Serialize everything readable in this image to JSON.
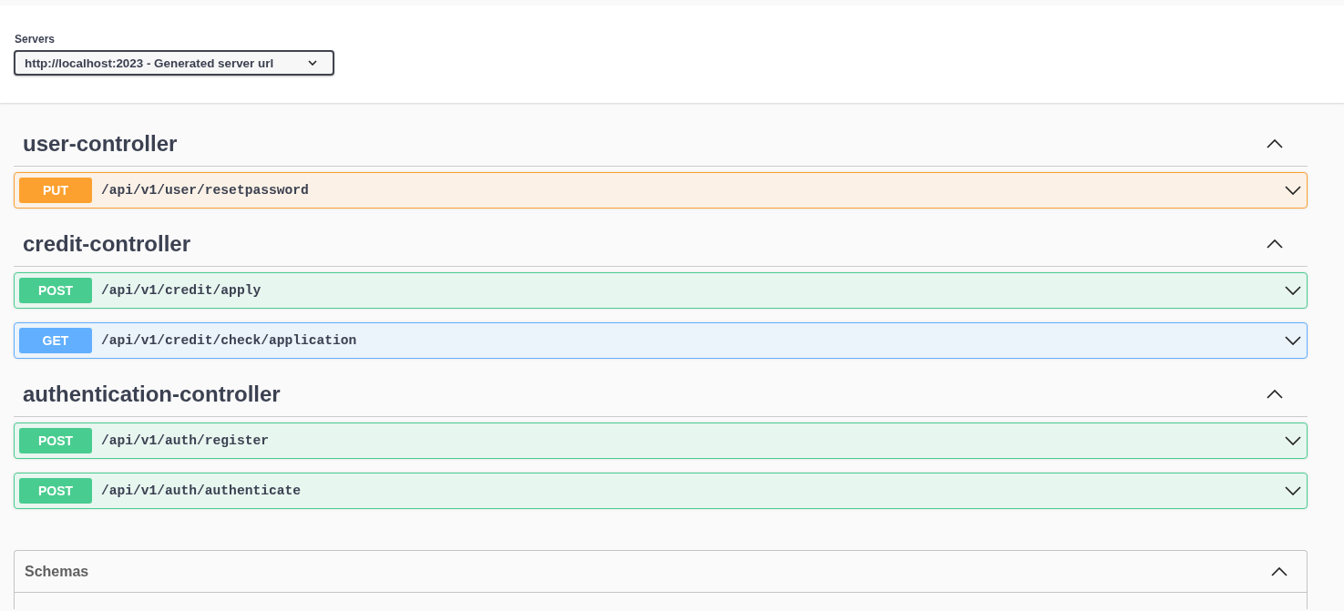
{
  "servers": {
    "label": "Servers",
    "selected": "http://localhost:2023 - Generated server url"
  },
  "tags": [
    {
      "name": "user-controller",
      "expanded": true,
      "operations": [
        {
          "kind": "put",
          "method": "PUT",
          "path": "/api/v1/user/resetpassword",
          "expanded": false
        }
      ]
    },
    {
      "name": "credit-controller",
      "expanded": true,
      "operations": [
        {
          "kind": "post",
          "method": "POST",
          "path": "/api/v1/credit/apply",
          "expanded": false
        },
        {
          "kind": "get",
          "method": "GET",
          "path": "/api/v1/credit/check/application",
          "expanded": false
        }
      ]
    },
    {
      "name": "authentication-controller",
      "expanded": true,
      "operations": [
        {
          "kind": "post",
          "method": "POST",
          "path": "/api/v1/auth/register",
          "expanded": false
        },
        {
          "kind": "post",
          "method": "POST",
          "path": "/api/v1/auth/authenticate",
          "expanded": false
        }
      ]
    }
  ],
  "schemas": {
    "title": "Schemas",
    "expanded": true
  }
}
